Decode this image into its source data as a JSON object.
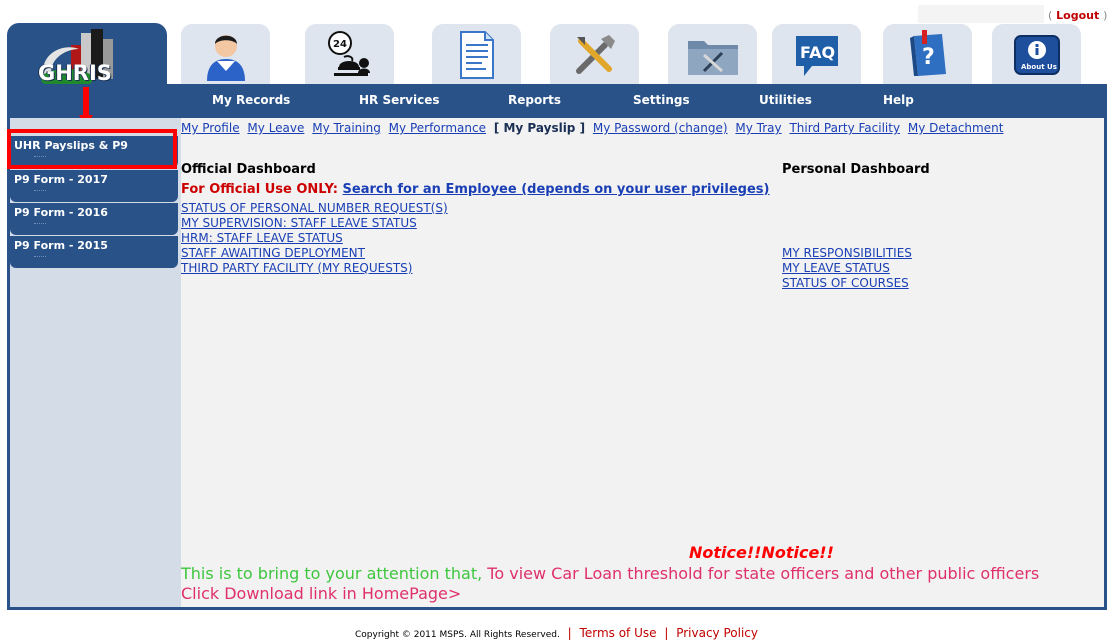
{
  "header": {
    "logo_text": "GHRIS",
    "logout_open": "(",
    "logout_label": "Logout",
    "logout_close": ")",
    "about_label": "About Us",
    "faq_label": "FAQ",
    "help_label": "?"
  },
  "nav": {
    "items": [
      "My Records",
      "HR Services",
      "Reports",
      "Settings",
      "Utilities",
      "Help"
    ]
  },
  "sidebar": {
    "items": [
      "UHR Payslips & P9",
      "P9 Form - 2017",
      "P9 Form - 2016",
      "P9 Form - 2015"
    ]
  },
  "subnav": {
    "links": [
      "My Profile",
      "My Leave",
      "My Training",
      "My Performance"
    ],
    "current": "[ My Payslip ]",
    "links_after": [
      "My Password (change)",
      "My Tray",
      "Third Party Facility",
      "My Detachment"
    ]
  },
  "official": {
    "title": "Official Dashboard",
    "note_label": "For Official Use ONLY:",
    "note_link": "Search for an Employee (depends on your user privileges)",
    "links": [
      "STATUS OF PERSONAL NUMBER REQUEST(S)",
      "MY SUPERVISION: STAFF LEAVE STATUS",
      "HRM: STAFF LEAVE STATUS",
      "STAFF AWAITING DEPLOYMENT",
      "THIRD PARTY FACILITY (MY REQUESTS)"
    ]
  },
  "personal": {
    "title": "Personal Dashboard",
    "links": [
      "MY RESPONSIBILITIES",
      "MY LEAVE STATUS",
      "STATUS OF COURSES"
    ]
  },
  "notice": {
    "title": "Notice!!Notice!!",
    "green": "This is to bring to your attention that,",
    "red": " To view Car Loan threshold for state officers and other public officers Click Download link in HomePage>"
  },
  "footer": {
    "copyright": "Copyright © 2011 MSPS. All Rights Reserved.",
    "separator": "|",
    "terms": "Terms of Use",
    "privacy": "Privacy Policy"
  },
  "colors": {
    "brand_blue": "#295388",
    "link_blue": "#1a3fb5",
    "highlight_red": "#ff0000",
    "content_bg": "#f2f2f2",
    "sidebar_bg": "#d4dce8"
  }
}
